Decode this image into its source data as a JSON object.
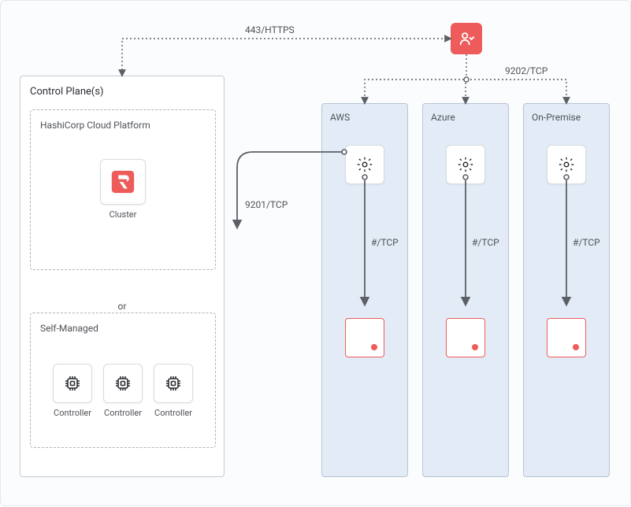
{
  "controlPlane": {
    "title": "Control Plane(s)",
    "hcp": {
      "title": "HashiCorp Cloud Platform",
      "clusterLabel": "Cluster"
    },
    "orLabel": "or",
    "selfManaged": {
      "title": "Self-Managed",
      "controllerLabel": "Controller"
    }
  },
  "user": {
    "iconName": "user-icon"
  },
  "connections": {
    "userToControlPlane": "443/HTTPS",
    "userToWorkers": "9202/TCP",
    "workerToControlPlane": "9201/TCP",
    "workerToTarget": "#/TCP"
  },
  "environments": [
    {
      "name": "AWS"
    },
    {
      "name": "Azure"
    },
    {
      "name": "On-Premise"
    }
  ],
  "colors": {
    "accent": "#ee5b5b",
    "envBg": "#e3ecf6",
    "line": "#5b5f66"
  }
}
